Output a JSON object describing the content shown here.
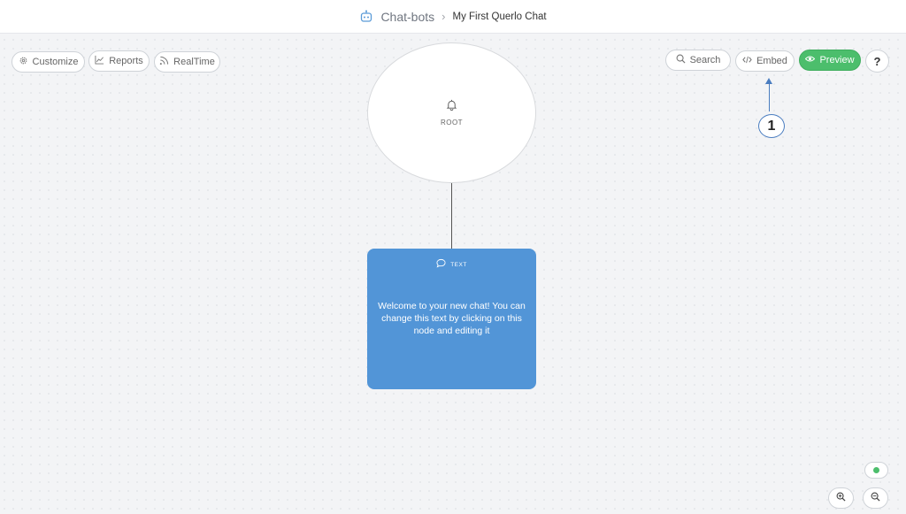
{
  "breadcrumb": {
    "root": "Chat-bots",
    "separator": "›",
    "current": "My First Querlo Chat",
    "root_icon": "robot-icon"
  },
  "toolbar_left": {
    "customize_label": "Customize",
    "reports_label": "Reports",
    "realtime_label": "RealTime"
  },
  "toolbar_right": {
    "search_label": "Search",
    "embed_label": "Embed",
    "preview_label": "Preview",
    "help_label": "?"
  },
  "canvas": {
    "root_node": {
      "label": "ROOT",
      "icon": "bell-icon"
    },
    "text_node": {
      "type_label": "TEXT",
      "icon": "speech-bubble-icon",
      "body": "Welcome to your new chat! You can change this text by clicking on this node and editing it"
    }
  },
  "annotation": {
    "number": "1",
    "color": "#4a7dc0"
  },
  "colors": {
    "accent_green": "#4cbe6c",
    "node_blue": "#5295d7",
    "background": "#f3f4f6"
  }
}
